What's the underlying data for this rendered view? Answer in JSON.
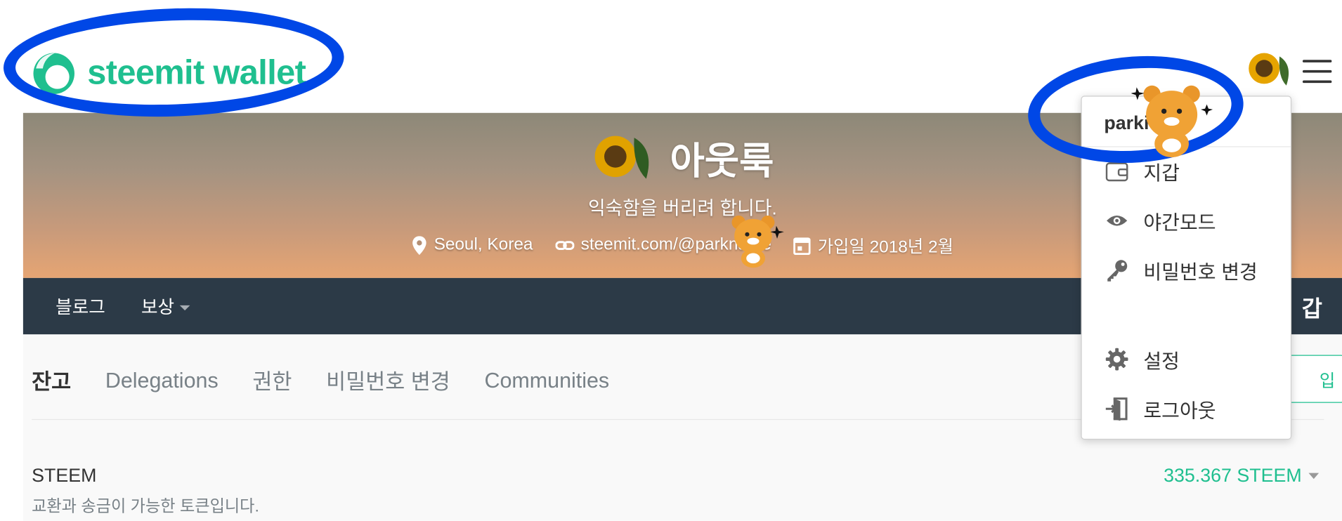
{
  "header": {
    "logo_text": "steemit wallet",
    "menu_icon": "hamburger-icon"
  },
  "profile": {
    "name": "아웃룩",
    "about": "익숙함을 버리려 합니다.",
    "location": "Seoul, Korea",
    "website": "steemit.com/@parkname",
    "joined": "가입일 2018년 2월"
  },
  "nav": {
    "items": [
      "블로그",
      "보상"
    ],
    "right_label": "갑"
  },
  "tabs": [
    {
      "label": "잔고",
      "active": true
    },
    {
      "label": "Delegations",
      "active": false
    },
    {
      "label": "권한",
      "active": false
    },
    {
      "label": "비밀번호 변경",
      "active": false
    },
    {
      "label": "Communities",
      "active": false
    }
  ],
  "right_button": "입",
  "balance": {
    "title": "STEEM",
    "description": "교환과 송금이 가능한 토큰입니다.",
    "amount": "335.367 STEEM"
  },
  "dropdown": {
    "username": "parki",
    "items": [
      {
        "label": "지갑",
        "icon": "wallet-icon"
      },
      {
        "label": "야간모드",
        "icon": "eye-icon"
      },
      {
        "label": "비밀번호 변경",
        "icon": "key-icon"
      },
      {
        "label": "설정",
        "icon": "gear-icon"
      },
      {
        "label": "로그아웃",
        "icon": "logout-icon"
      }
    ]
  },
  "colors": {
    "brand": "#1fbf8f",
    "nav_bg": "#2c3a47",
    "annotation": "#0047e6"
  }
}
